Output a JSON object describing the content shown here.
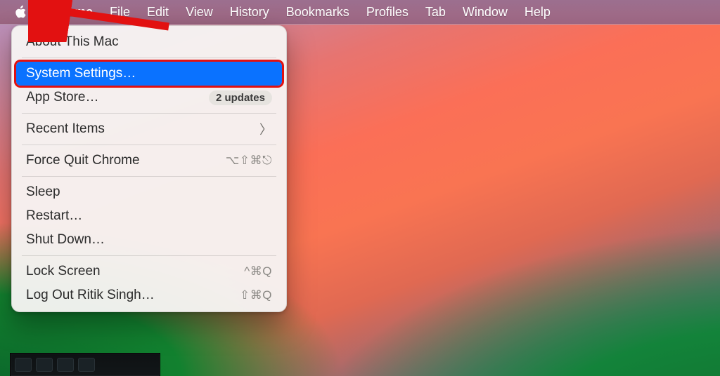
{
  "menubar": {
    "app_name": "Chrome",
    "items": [
      "File",
      "Edit",
      "View",
      "History",
      "Bookmarks",
      "Profiles",
      "Tab",
      "Window",
      "Help"
    ]
  },
  "apple_menu": {
    "about": "About This Mac",
    "system_settings": "System Settings…",
    "app_store": "App Store…",
    "app_store_badge": "2 updates",
    "recent_items": "Recent Items",
    "force_quit": "Force Quit Chrome",
    "force_quit_shortcut": "⌥⇧⌘⎋",
    "sleep": "Sleep",
    "restart": "Restart…",
    "shut_down": "Shut Down…",
    "lock_screen": "Lock Screen",
    "lock_screen_shortcut": "^⌘Q",
    "log_out": "Log Out Ritik Singh…",
    "log_out_shortcut": "⇧⌘Q"
  },
  "annotation": {
    "highlighted_item": "system_settings"
  }
}
